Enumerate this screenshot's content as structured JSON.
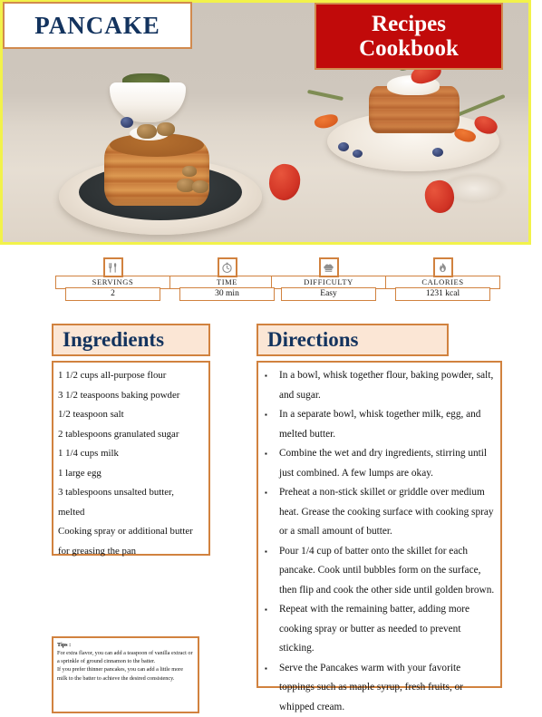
{
  "header": {
    "recipe_title": "PANCAKE",
    "cookbook_line1": "Recipes",
    "cookbook_line2": "Cookbook",
    "brand_red": "#c10a0a",
    "accent_orange": "#d1823f",
    "navy": "#13335e",
    "photo_border": "#f2f24a"
  },
  "photo": {
    "alt": "Stacks of pancakes on plates with strawberries, blueberries and walnuts"
  },
  "stats": [
    {
      "icon": "cutlery-icon",
      "label": "SERVINGS",
      "value": "2"
    },
    {
      "icon": "clock-icon",
      "label": "TIME",
      "value": "30 min"
    },
    {
      "icon": "chef-hat-icon",
      "label": "DIFFICULTY",
      "value": "Easy"
    },
    {
      "icon": "flame-icon",
      "label": "CALORIES",
      "value": "1231 kcal"
    }
  ],
  "ingredients": {
    "heading": "Ingredients",
    "items": [
      "1 1/2 cups all-purpose flour",
      "3 1/2 teaspoons baking powder",
      "1/2 teaspoon salt",
      "2 tablespoons granulated sugar",
      "1 1/4 cups milk",
      "1 large egg",
      "3 tablespoons unsalted butter,",
      "melted",
      "Cooking spray or additional butter",
      "for greasing the pan"
    ]
  },
  "directions": {
    "heading": "Directions",
    "steps": [
      "In a bowl, whisk together flour, baking powder, salt, and sugar.",
      "In a separate bowl, whisk together milk, egg, and melted butter.",
      "Combine the wet and dry ingredients, stirring until just combined. A few lumps are okay.",
      "Preheat a non-stick skillet or griddle over medium heat. Grease the cooking surface with cooking spray or a small amount of butter.",
      "Pour 1/4 cup of batter onto the skillet for each pancake. Cook until bubbles form on the surface, then flip and cook the other side until golden brown.",
      "Repeat with the remaining batter, adding more cooking spray or butter as needed to prevent sticking.",
      "Serve the Pancakes warm with your favorite toppings such as maple syrup, fresh fruits, or whipped cream."
    ]
  },
  "tips": {
    "title": "Tips :",
    "paragraphs": [
      "For extra flavor, you can add a teaspoon of vanilla extract or a sprinkle of ground cinnamon to the batter.",
      "If you prefer thinner pancakes, you can add a little more milk to the batter to achieve the desired consistency."
    ]
  }
}
